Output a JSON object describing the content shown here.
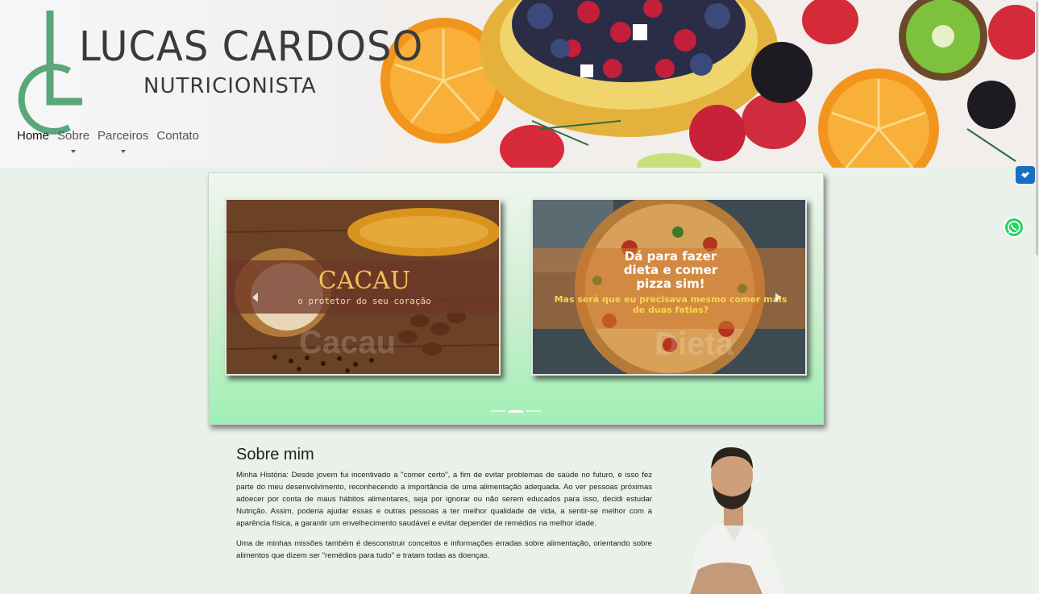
{
  "brand": {
    "name": "LUCAS CARDOSO",
    "subtitle": "NUTRICIONISTA"
  },
  "nav": [
    {
      "label": "Home",
      "active": true,
      "dropdown": false
    },
    {
      "label": "Sobre",
      "active": false,
      "dropdown": true
    },
    {
      "label": "Parceiros",
      "active": false,
      "dropdown": true
    },
    {
      "label": "Contato",
      "active": false,
      "dropdown": false
    }
  ],
  "carousel": {
    "slides": [
      {
        "heading": "CACAU",
        "subheading": "o protetor do seu coração",
        "watermark": "Cacau"
      },
      {
        "heading": "Dá para fazer dieta e comer pizza sim!",
        "subheading": "Mas será que eu precisava mesmo comer mais de duas fatias?",
        "watermark": "Dieta"
      }
    ],
    "indicator_count": 3,
    "active_indicator": 1
  },
  "about": {
    "title": "Sobre mim",
    "paragraphs": [
      "Minha História: Desde jovem fui incentivado a \"comer certo\", a fim de evitar problemas de saúde no futuro, e isso fez parte do meu desenvolvimento, reconhecendo a importância de uma alimentação adequada. Ao ver pessoas próximas adoecer por conta de maus hábitos alimentares, seja por ignorar ou não serem educados para isso, decidi estudar Nutrição. Assim, poderia ajudar essas e outras pessoas a ter melhor qualidade de vida, a sentir-se melhor com a aparência física, a garantir um envelhecimento saudável e evitar depender de remédios na melhor idade.",
      "Uma de minhas missões também é desconstruir conceitos e informações erradas sobre alimentação, orientando sobre alimentos que dizem ser \"remédios para tudo\" e tratam todas as doenças."
    ]
  },
  "colors": {
    "accent": "#5aa77a",
    "background": "#e9f1ea",
    "whatsapp": "#25d366",
    "access": "#1a6ec2"
  },
  "icons": {
    "logo": "lc-monogram-logo",
    "accessibility": "accessibility-hand-icon",
    "whatsapp": "whatsapp-icon"
  }
}
